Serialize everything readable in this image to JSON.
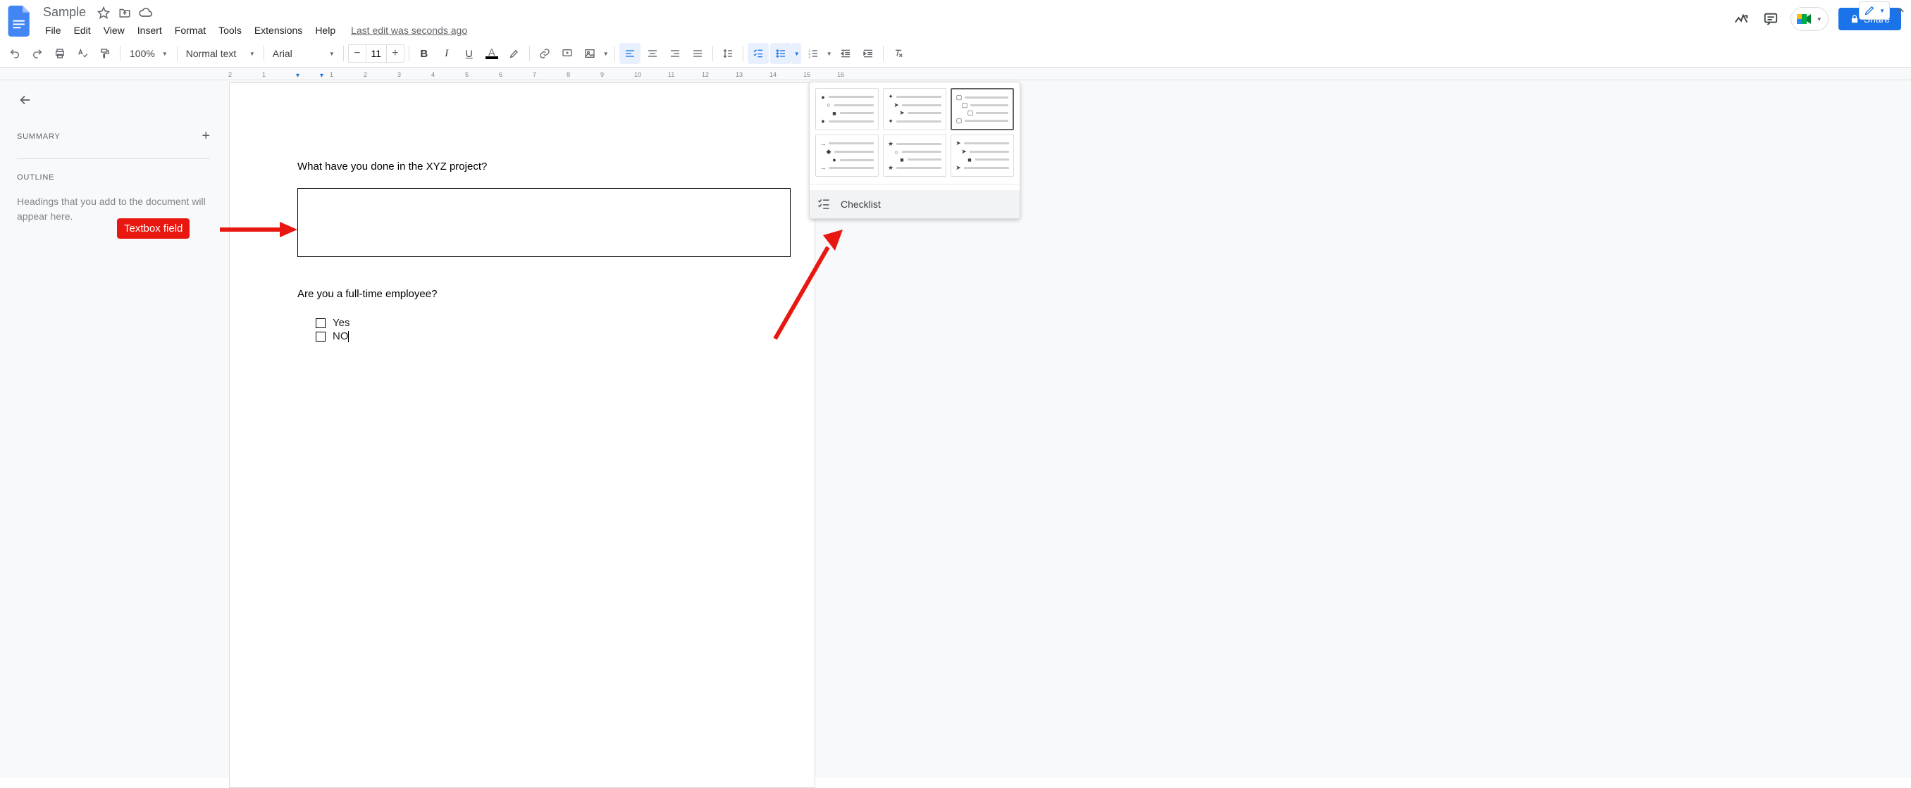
{
  "doc": {
    "title": "Sample",
    "last_edit": "Last edit was seconds ago"
  },
  "menus": {
    "file": "File",
    "edit": "Edit",
    "view": "View",
    "insert": "Insert",
    "format": "Format",
    "tools": "Tools",
    "extensions": "Extensions",
    "help": "Help"
  },
  "header": {
    "share": "Share"
  },
  "toolbar": {
    "zoom": "100%",
    "paragraph_style": "Normal text",
    "font": "Arial",
    "font_size": "11"
  },
  "sidebar": {
    "summary": "SUMMARY",
    "outline": "OUTLINE",
    "outline_hint": "Headings that you add to the document will appear here."
  },
  "content": {
    "q1": "What have you done in the XYZ project?",
    "q2": "Are you a full-time employee?",
    "opt_yes": "Yes",
    "opt_no": "NO"
  },
  "ruler": {
    "nums": [
      "2",
      "1",
      "1",
      "2",
      "3",
      "4",
      "5",
      "6",
      "7",
      "8",
      "9",
      "10",
      "11",
      "12",
      "13",
      "14",
      "15",
      "16"
    ]
  },
  "popover": {
    "checklist": "Checklist"
  },
  "annotation": {
    "textbox_label": "Textbox field"
  }
}
